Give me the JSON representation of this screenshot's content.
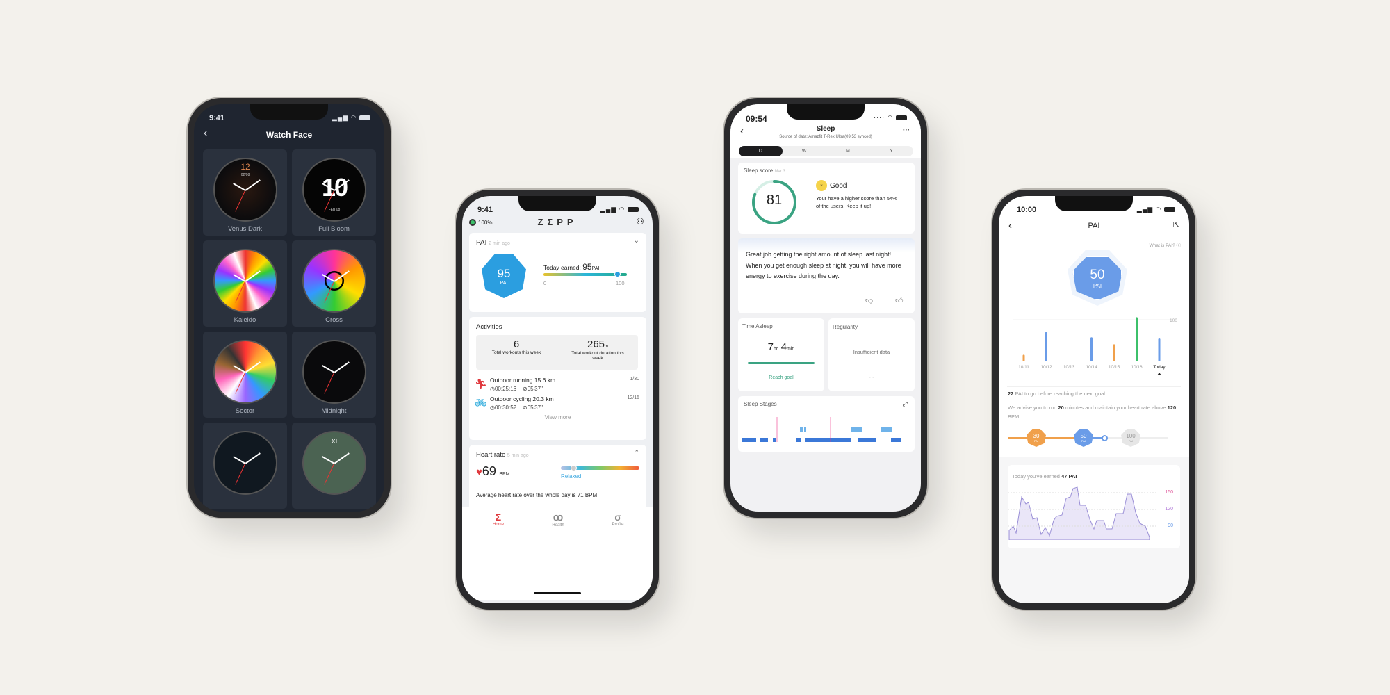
{
  "phone1": {
    "time": "9:41",
    "title": "Watch Face",
    "back_icon": "chevron-left-icon",
    "faces": [
      {
        "name": "Venus Dark",
        "date": "02/08",
        "hour": "12"
      },
      {
        "name": "Full Bloom",
        "big": "10",
        "date": "FEB 08"
      },
      {
        "name": "Kaleido"
      },
      {
        "name": "Cross"
      },
      {
        "name": "Sector"
      },
      {
        "name": "Midnight"
      },
      {
        "name": ""
      },
      {
        "name": "",
        "numerals": "XI"
      }
    ]
  },
  "phone2": {
    "time": "9:41",
    "battery": "100%",
    "logo": "ZΣPP",
    "pai": {
      "title": "PAI",
      "ago": "2 min ago",
      "value": "95",
      "unit": "PAI",
      "earned_label": "Today earned:",
      "earned_value": "95",
      "earned_unit": "PAI",
      "min": "0",
      "max": "100",
      "progress": 0.95
    },
    "activities": {
      "title": "Activities",
      "workouts": "6",
      "workouts_label": "Total workouts this week",
      "duration": "265",
      "duration_unit": "m",
      "duration_label": "Total workout duration this week",
      "items": [
        {
          "name": "Outdoor running 15.6 km",
          "time": "00:25:16",
          "pace": "05'37''",
          "date": "1/30",
          "icon": "running-icon",
          "color": "#e0393e"
        },
        {
          "name": "Outdoor cycling 20.3 km",
          "time": "00:30:52",
          "pace": "05'37''",
          "date": "12/15",
          "icon": "cycling-icon",
          "color": "#1aa3d9"
        }
      ],
      "view_more": "View more"
    },
    "heart": {
      "title": "Heart rate",
      "ago": "5 min ago",
      "value": "69",
      "unit": "BPM",
      "state": "Relaxed",
      "average": "Average heart rate over the whole day is 71 BPM"
    },
    "tabs": [
      {
        "label": "Home",
        "icon": "Σ",
        "active": true
      },
      {
        "label": "Health",
        "icon": "ꝏ",
        "active": false
      },
      {
        "label": "Profile",
        "icon": "σ",
        "active": false
      }
    ]
  },
  "phone3": {
    "time": "09:54",
    "title": "Sleep",
    "source": "Source of data:  Amazfit T-Rex Ultra(09:53 synced)",
    "more": "···",
    "periods": [
      "D",
      "W",
      "M",
      "Y"
    ],
    "active_period": "D",
    "score": {
      "title": "Sleep score",
      "date": "Mar 3",
      "value": "81",
      "fraction": 0.81,
      "rating": "Good",
      "desc": "Your have a higher score than 54% of the users. Keep it up!"
    },
    "advice": "Great job getting the right amount of sleep last night! When you get enough sleep at night, you will have more energy to exercise during the day.",
    "asleep": {
      "title": "Time Asleep",
      "hours": "7",
      "hr": "hr",
      "minutes": "4",
      "min": "min",
      "status": "Reach goal"
    },
    "regularity": {
      "title": "Regularity",
      "status": "Insufficient data",
      "value": "- -"
    },
    "stages": {
      "title": "Sleep Stages"
    }
  },
  "phone4": {
    "time": "10:00",
    "title": "PAI",
    "help": "What is PAI?",
    "value": "50",
    "unit": "PAI",
    "chart_data": {
      "type": "bar",
      "categories": [
        "10/11",
        "10/12",
        "10/13",
        "10/14",
        "10/15",
        "10/16",
        "Today"
      ],
      "values": [
        16,
        71,
        0,
        58,
        41,
        106,
        55
      ],
      "colors": [
        "#f0a04b",
        "#6a9ce8",
        "#6a9ce8",
        "#6a9ce8",
        "#f0a04b",
        "#3cc06a",
        "#6a9ce8"
      ],
      "ref_label": "100",
      "ylim": [
        0,
        110
      ]
    },
    "to_go": "22",
    "to_go_text": "PAI to go before reaching the next goal",
    "advise_a": "We advise you to run",
    "advise_min": "20",
    "advise_b": "minutes and maintain your heart rate above",
    "advise_bpm": "120",
    "advise_c": "BPM",
    "levels": [
      {
        "v": "30",
        "u": "PAI",
        "color": "#f0a04b"
      },
      {
        "v": "50",
        "u": "PAI",
        "color": "#6a9ce8"
      },
      {
        "v": "100",
        "u": "PAI",
        "color": "#e6e6e6"
      }
    ],
    "earned_prefix": "Today you've earned",
    "earned": "47 PAI",
    "hr_ticks": [
      "150",
      "120",
      "90"
    ]
  }
}
